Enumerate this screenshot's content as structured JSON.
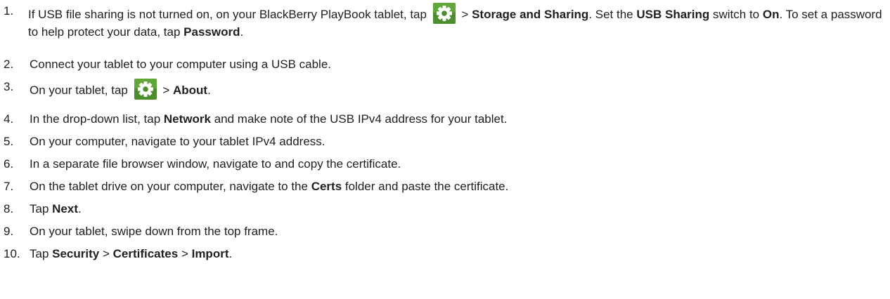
{
  "steps": [
    {
      "num": "1.",
      "parts": {
        "a": "If USB file sharing is not turned on, on your BlackBerry PlayBook tablet, tap ",
        "b": " > ",
        "c": "Storage and Sharing",
        "d": ". Set the ",
        "e": "USB Sharing",
        "f": " switch to ",
        "g": "On",
        "h": ". To set a password to help protect your data, tap ",
        "i": "Password",
        "j": "."
      },
      "icon": "gear-icon"
    },
    {
      "num": "2.",
      "text": "Connect your tablet to your computer using a USB cable."
    },
    {
      "num": "3.",
      "parts": {
        "a": "On your tablet, tap ",
        "b": " > ",
        "c": "About",
        "d": "."
      },
      "icon": "gear-icon"
    },
    {
      "num": "4.",
      "parts": {
        "a": "In the drop-down list, tap ",
        "b": "Network",
        "c": " and make note of the USB IPv4 address for your tablet."
      }
    },
    {
      "num": "5.",
      "text": "On your computer, navigate to your tablet IPv4 address."
    },
    {
      "num": "6.",
      "text": "In a separate file browser window, navigate to and copy the certificate."
    },
    {
      "num": "7.",
      "parts": {
        "a": "On the tablet drive on your computer, navigate to the ",
        "b": "Certs",
        "c": " folder and paste the certificate."
      }
    },
    {
      "num": "8.",
      "parts": {
        "a": "Tap ",
        "b": "Next",
        "c": "."
      }
    },
    {
      "num": "9.",
      "text": "On your tablet, swipe down from the top frame."
    },
    {
      "num": "10.",
      "parts": {
        "a": "Tap ",
        "b": "Security",
        "c": " > ",
        "d": "Certificates",
        "e": " > ",
        "f": "Import",
        "g": "."
      }
    }
  ],
  "colors": {
    "text": "#1f1f1f",
    "icon_bg": "#4a8f2c",
    "icon_gear": "#ffffff"
  }
}
